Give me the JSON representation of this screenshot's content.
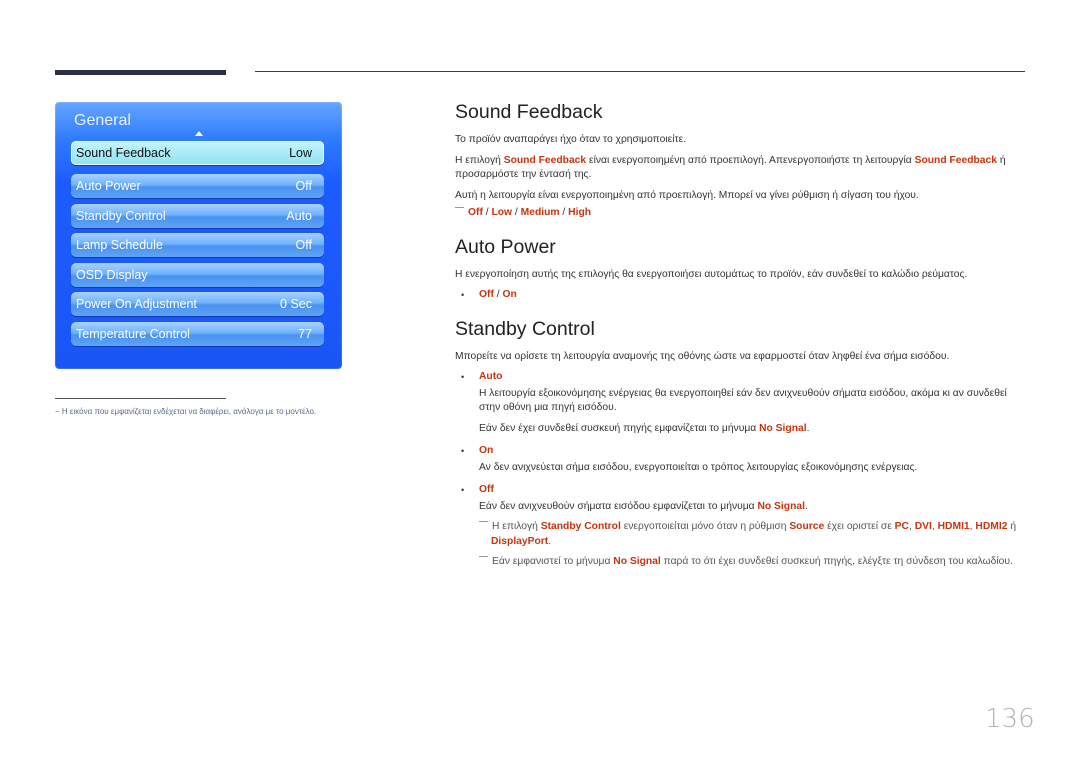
{
  "osd": {
    "title": "General",
    "items": [
      {
        "label": "Sound Feedback",
        "value": "Low",
        "selected": true
      },
      {
        "label": "Auto Power",
        "value": "Off"
      },
      {
        "label": "Standby Control",
        "value": "Auto"
      },
      {
        "label": "Lamp Schedule",
        "value": "Off"
      },
      {
        "label": "OSD Display",
        "value": ""
      },
      {
        "label": "Power On Adjustment",
        "value": "0 Sec"
      },
      {
        "label": "Temperature Control",
        "value": "77"
      }
    ]
  },
  "footnote": "− Η εικόνα που εμφανίζεται ενδέχεται να διαφέρει, ανάλογα με το μοντέλο.",
  "sections": {
    "sound_feedback": {
      "title": "Sound Feedback",
      "p1": "Το προϊόν αναπαράγει ήχο όταν το χρησιμοποιείτε.",
      "p2_a": "Η επιλογή ",
      "p2_hl1": "Sound Feedback",
      "p2_b": " είναι ενεργοποιημένη από προεπιλογή. Απενεργοποιήστε τη λειτουργία ",
      "p2_hl2": "Sound Feedback",
      "p2_c": " ή προσαρμόστε την έντασή της.",
      "p3": "Αυτή η λειτουργία είναι ενεργοποιημένη από προεπιλογή. Μπορεί να γίνει ρύθμιση ή σίγαση του ήχου.",
      "options": [
        "Off",
        "Low",
        "Medium",
        "High"
      ],
      "sep": " / "
    },
    "auto_power": {
      "title": "Auto Power",
      "p1": "Η ενεργοποίηση αυτής της επιλογής θα ενεργοποιήσει αυτομάτως το προϊόν, εάν συνδεθεί το καλώδιο ρεύματος.",
      "options": [
        "Off",
        "On"
      ],
      "sep": " / "
    },
    "standby_control": {
      "title": "Standby Control",
      "p1": "Μπορείτε να ορίσετε τη λειτουργία αναμονής της οθόνης ώστε να εφαρμοστεί όταν ληφθεί ένα σήμα εισόδου.",
      "auto_label": "Auto",
      "auto_p1": "Η λειτουργία εξοικονόμησης ενέργειας θα ενεργοποιηθεί εάν δεν ανιχνευθούν σήματα εισόδου, ακόμα κι αν συνδεθεί στην οθόνη μια πηγή εισόδου.",
      "auto_p2_a": "Εάν δεν έχει συνδεθεί συσκευή πηγής εμφανίζεται το μήνυμα ",
      "auto_p2_hl": "No Signal",
      "auto_p2_b": ".",
      "on_label": "On",
      "on_p1": "Αν δεν ανιχνεύεται σήμα εισόδου, ενεργοποιείται ο τρόπος λειτουργίας εξοικονόμησης ενέργειας.",
      "off_label": "Off",
      "off_p1_a": "Εάν δεν ανιχνευθούν σήματα εισόδου εμφανίζεται το μήνυμα ",
      "off_p1_hl": "No Signal",
      "off_p1_b": ".",
      "note1": {
        "a": "Η επιλογή ",
        "hl1": "Standby Control",
        "b": " ενεργοποιείται μόνο όταν η ρύθμιση ",
        "hl2": "Source",
        "c": " έχει οριστεί σε ",
        "hl3": "PC",
        "d": ", ",
        "hl4": "DVI",
        "e": ", ",
        "hl5": "HDMI1",
        "f": ", ",
        "hl6": "HDMI2",
        "g": " ή ",
        "hl7": "DisplayPort",
        "h": "."
      },
      "note2": {
        "a": "Εάν εμφανιστεί το μήνυμα ",
        "hl1": "No Signal",
        "b": " παρά το ότι έχει συνδεθεί συσκευή πηγής, ελέγξτε τη σύνδεση του καλωδίου."
      }
    }
  },
  "page_number": "136",
  "colors": {
    "highlight": "#c8340e",
    "osd_blue": "#1c5cff",
    "osd_selected": "#a9ecf7"
  }
}
